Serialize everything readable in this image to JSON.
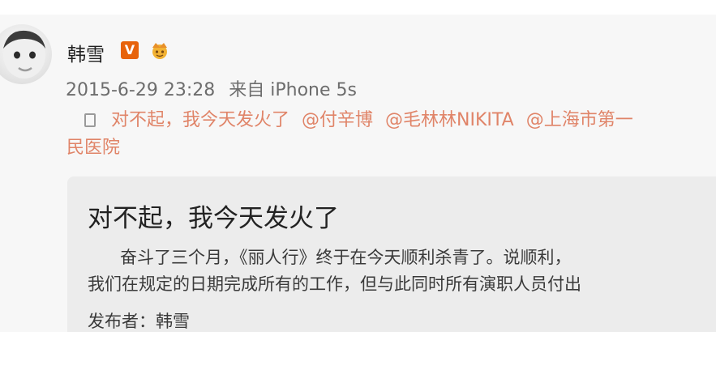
{
  "post": {
    "username": "韩雪",
    "verified_badge": "V",
    "crown_icon": "crown-icon",
    "timestamp": "2015-6-29 23:28",
    "source": "来自 iPhone 5s",
    "text_line1": "对不起，我今天发火了",
    "mentions": [
      "@付辛博",
      "@毛林林NIKITA",
      "@上海市第一"
    ],
    "text_line2": "民医院",
    "doc_icon": "document-icon"
  },
  "card": {
    "title": "对不起，我今天发火了",
    "body_line1": "奋斗了三个月，《丽人行》终于在今天顺利杀青了。说顺利，",
    "body_line2": "我们在规定的日期完成所有的工作，但与此同时所有演职人员付出",
    "publisher_label": "发布者：",
    "publisher_name": "韩雪"
  },
  "colors": {
    "link": "#e08468",
    "badge": "#e7630b",
    "card_bg": "#ececec"
  }
}
